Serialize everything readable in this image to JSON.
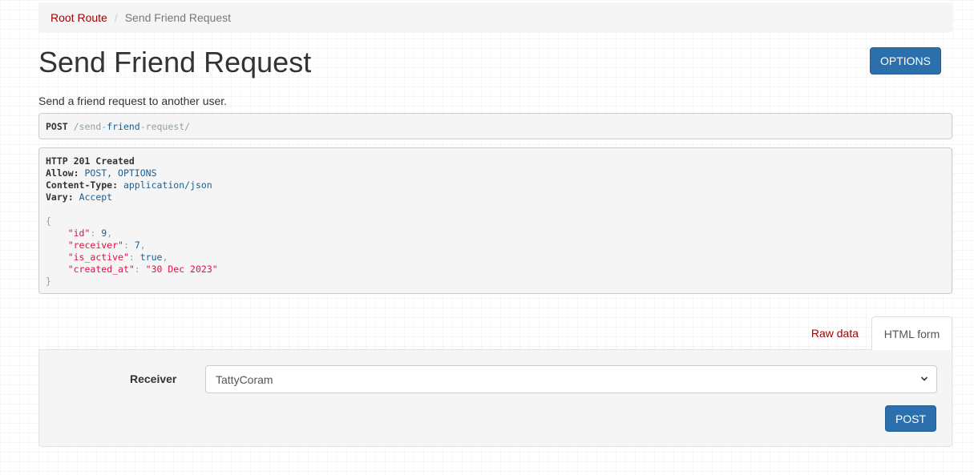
{
  "breadcrumb": {
    "root": "Root Route",
    "current": "Send Friend Request"
  },
  "page": {
    "title": "Send Friend Request",
    "description": "Send a friend request to another user.",
    "options_label": "OPTIONS"
  },
  "request": {
    "method": "POST",
    "path_part1": "/send-",
    "path_part2": "friend",
    "path_part3": "-request/"
  },
  "response": {
    "status": "HTTP 201 Created",
    "headers": [
      {
        "key": "Allow:",
        "value": "POST, OPTIONS"
      },
      {
        "key": "Content-Type:",
        "value": "application/json"
      },
      {
        "key": "Vary:",
        "value": "Accept"
      }
    ],
    "body": {
      "id_key": "\"id\"",
      "id_val": "9",
      "receiver_key": "\"receiver\"",
      "receiver_val": "7",
      "active_key": "\"is_active\"",
      "active_val": "true",
      "created_key": "\"created_at\"",
      "created_val": "\"30 Dec 2023\""
    }
  },
  "tabs": {
    "raw": "Raw data",
    "form": "HTML form"
  },
  "form": {
    "receiver_label": "Receiver",
    "receiver_value": "TattyCoram",
    "submit_label": "POST"
  },
  "colors": {
    "accent": "#2c6fad",
    "link": "#a30000"
  }
}
